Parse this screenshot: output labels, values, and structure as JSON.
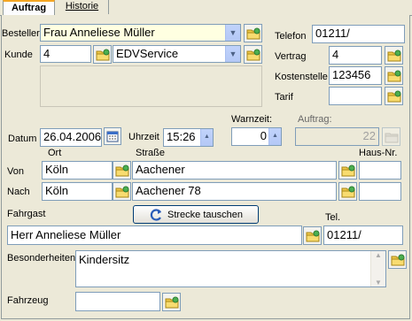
{
  "tabs": [
    {
      "label": "Auftrag"
    },
    {
      "label": "Historie"
    }
  ],
  "besteller": {
    "label": "Besteller",
    "value": "Frau Anneliese Müller"
  },
  "kunde": {
    "label": "Kunde",
    "number": "4",
    "name": "EDVService"
  },
  "telefon": {
    "label": "Telefon",
    "value": "01211/"
  },
  "vertrag": {
    "label": "Vertrag",
    "value": "4"
  },
  "kostenstelle": {
    "label": "Kostenstelle",
    "value": "123456"
  },
  "tarif": {
    "label": "Tarif",
    "value": ""
  },
  "datum": {
    "label": "Datum",
    "value": "26.04.2006"
  },
  "uhrzeit": {
    "label": "Uhrzeit",
    "value": "15:26"
  },
  "wartezeit": {
    "label": "Warnzeit:",
    "value": "0"
  },
  "auftrag": {
    "label": "Auftrag:",
    "value": "22"
  },
  "route_headers": {
    "ort": "Ort",
    "strasse": "Straße",
    "hausnr": "Haus-Nr."
  },
  "von": {
    "label": "Von",
    "ort": "Köln",
    "strasse": "Aachener",
    "hausnr": ""
  },
  "nach": {
    "label": "Nach",
    "ort": "Köln",
    "strasse": "Aachener 78",
    "hausnr": ""
  },
  "swap_button": {
    "label": "Strecke tauschen"
  },
  "fahrgast": {
    "label": "Fahrgast",
    "value": "Herr Anneliese Müller"
  },
  "tel": {
    "label": "Tel.",
    "value": "01211/"
  },
  "besonderheiten": {
    "label": "Besonderheiten",
    "value": "Kindersitz"
  },
  "fahrzeug": {
    "label": "Fahrzeug",
    "value": ""
  }
}
